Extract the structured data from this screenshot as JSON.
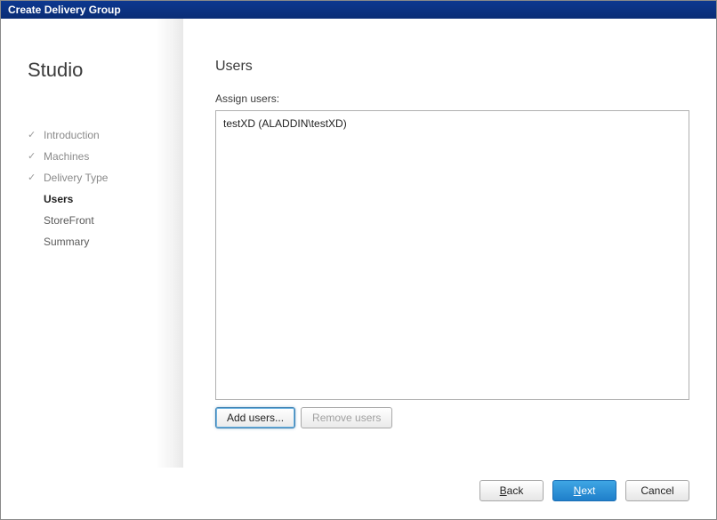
{
  "window": {
    "title": "Create Delivery Group"
  },
  "sidebar": {
    "title": "Studio",
    "steps": [
      {
        "label": "Introduction",
        "state": "completed"
      },
      {
        "label": "Machines",
        "state": "completed"
      },
      {
        "label": "Delivery Type",
        "state": "completed"
      },
      {
        "label": "Users",
        "state": "current"
      },
      {
        "label": "StoreFront",
        "state": "pending"
      },
      {
        "label": "Summary",
        "state": "pending"
      }
    ]
  },
  "main": {
    "title": "Users",
    "assign_label": "Assign users:",
    "users": [
      {
        "display": "testXD (ALADDIN\\testXD)"
      }
    ],
    "add_button": "Add users...",
    "remove_button": "Remove users"
  },
  "footer": {
    "back": "Back",
    "next": "Next",
    "cancel": "Cancel"
  }
}
